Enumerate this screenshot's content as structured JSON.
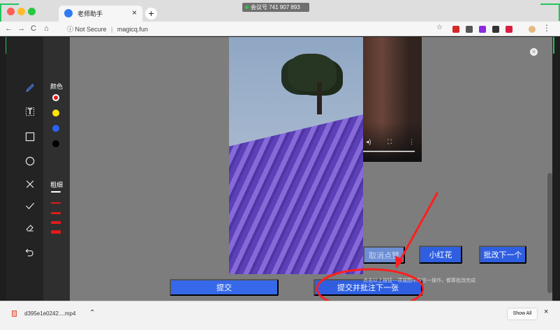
{
  "browser": {
    "tab_title": "老师助手",
    "meeting_badge": "会议号 741 907 893",
    "url_security": "ⓘ Not Secure",
    "url_host": "magicq.fun",
    "close_icon": "×",
    "new_tab_icon": "+"
  },
  "toolbar": {
    "icons": [
      "pen-icon",
      "text-icon",
      "rectangle-icon",
      "circle-icon",
      "cross-icon",
      "check-icon",
      "eraser-icon",
      "undo-icon"
    ]
  },
  "palette": {
    "color_label": "颜色",
    "thickness_label": "粗细",
    "colors": [
      "#e11b1b",
      "#ffe500",
      "#2a62f4",
      "#000000"
    ],
    "selected_color": "#e11b1b"
  },
  "actions": {
    "cancel_label": "取消点赞",
    "red_flower_label": "小红花",
    "grade_next_label": "批改下一个",
    "submit_label": "提交",
    "submit_next_label": "提交并批注下一张",
    "hint_text": "点击以上按钮一项或图中的任一操作，都算批改完成"
  },
  "downloads": {
    "file_name": "d395e1e0242....mp4",
    "show_all_label": "Show All",
    "close_icon": "×"
  },
  "annotations": {
    "accent_color": "#ff1f1f"
  }
}
